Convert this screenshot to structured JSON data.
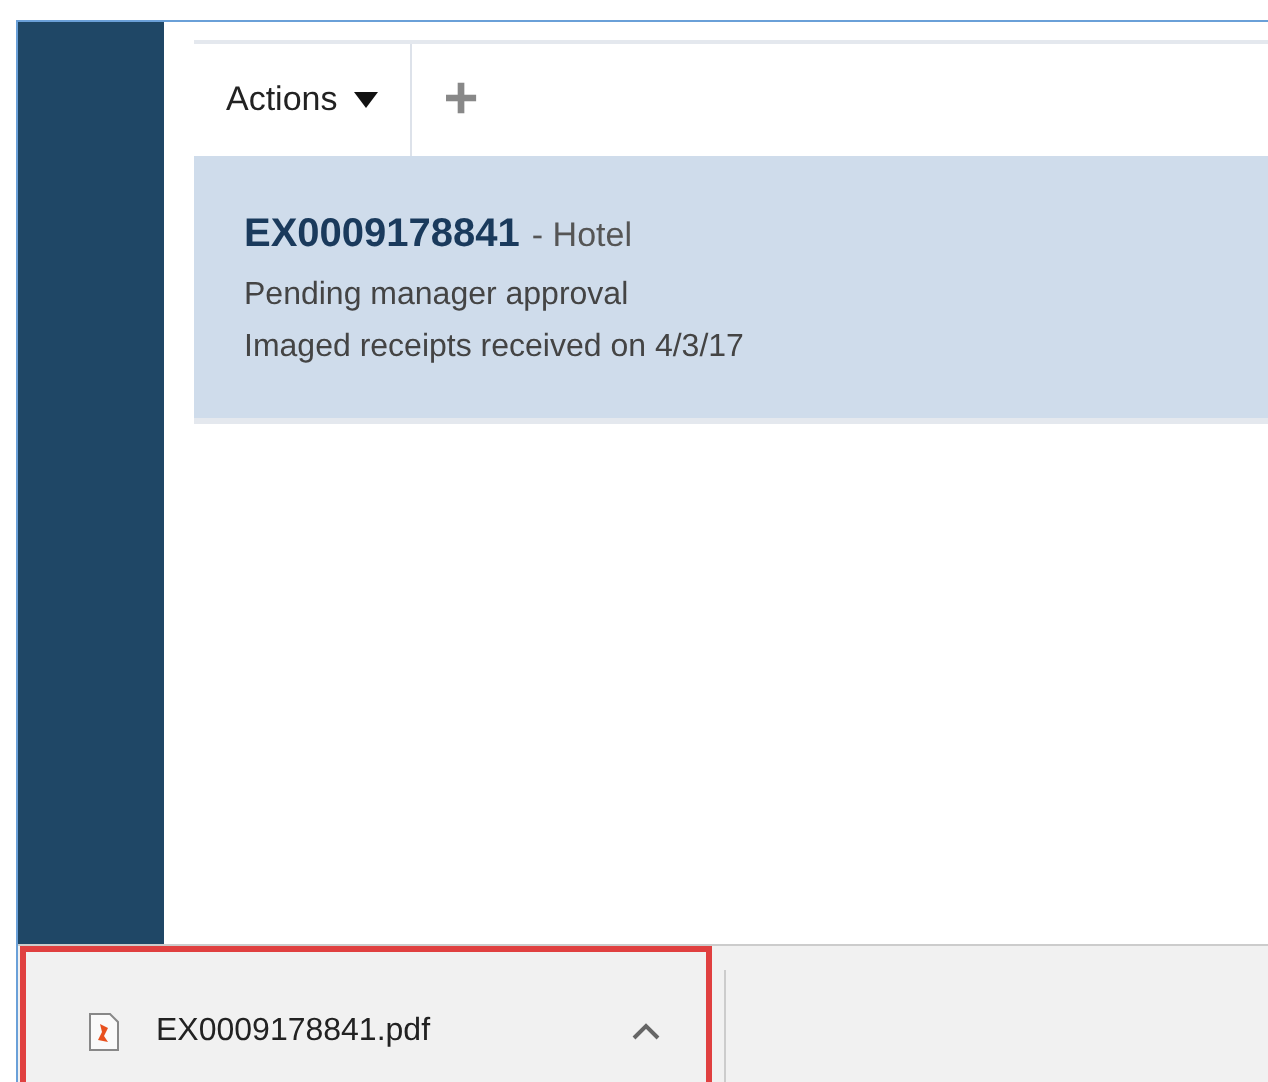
{
  "toolbar": {
    "actions_label": "Actions",
    "add_icon": "+"
  },
  "expense": {
    "id": "EX0009178841",
    "type": "- Hotel",
    "status": "Pending manager approval",
    "note": "Imaged receipts received on 4/3/17",
    "selected": true
  },
  "download": {
    "filename": "EX0009178841.pdf",
    "highlighted": true
  }
}
